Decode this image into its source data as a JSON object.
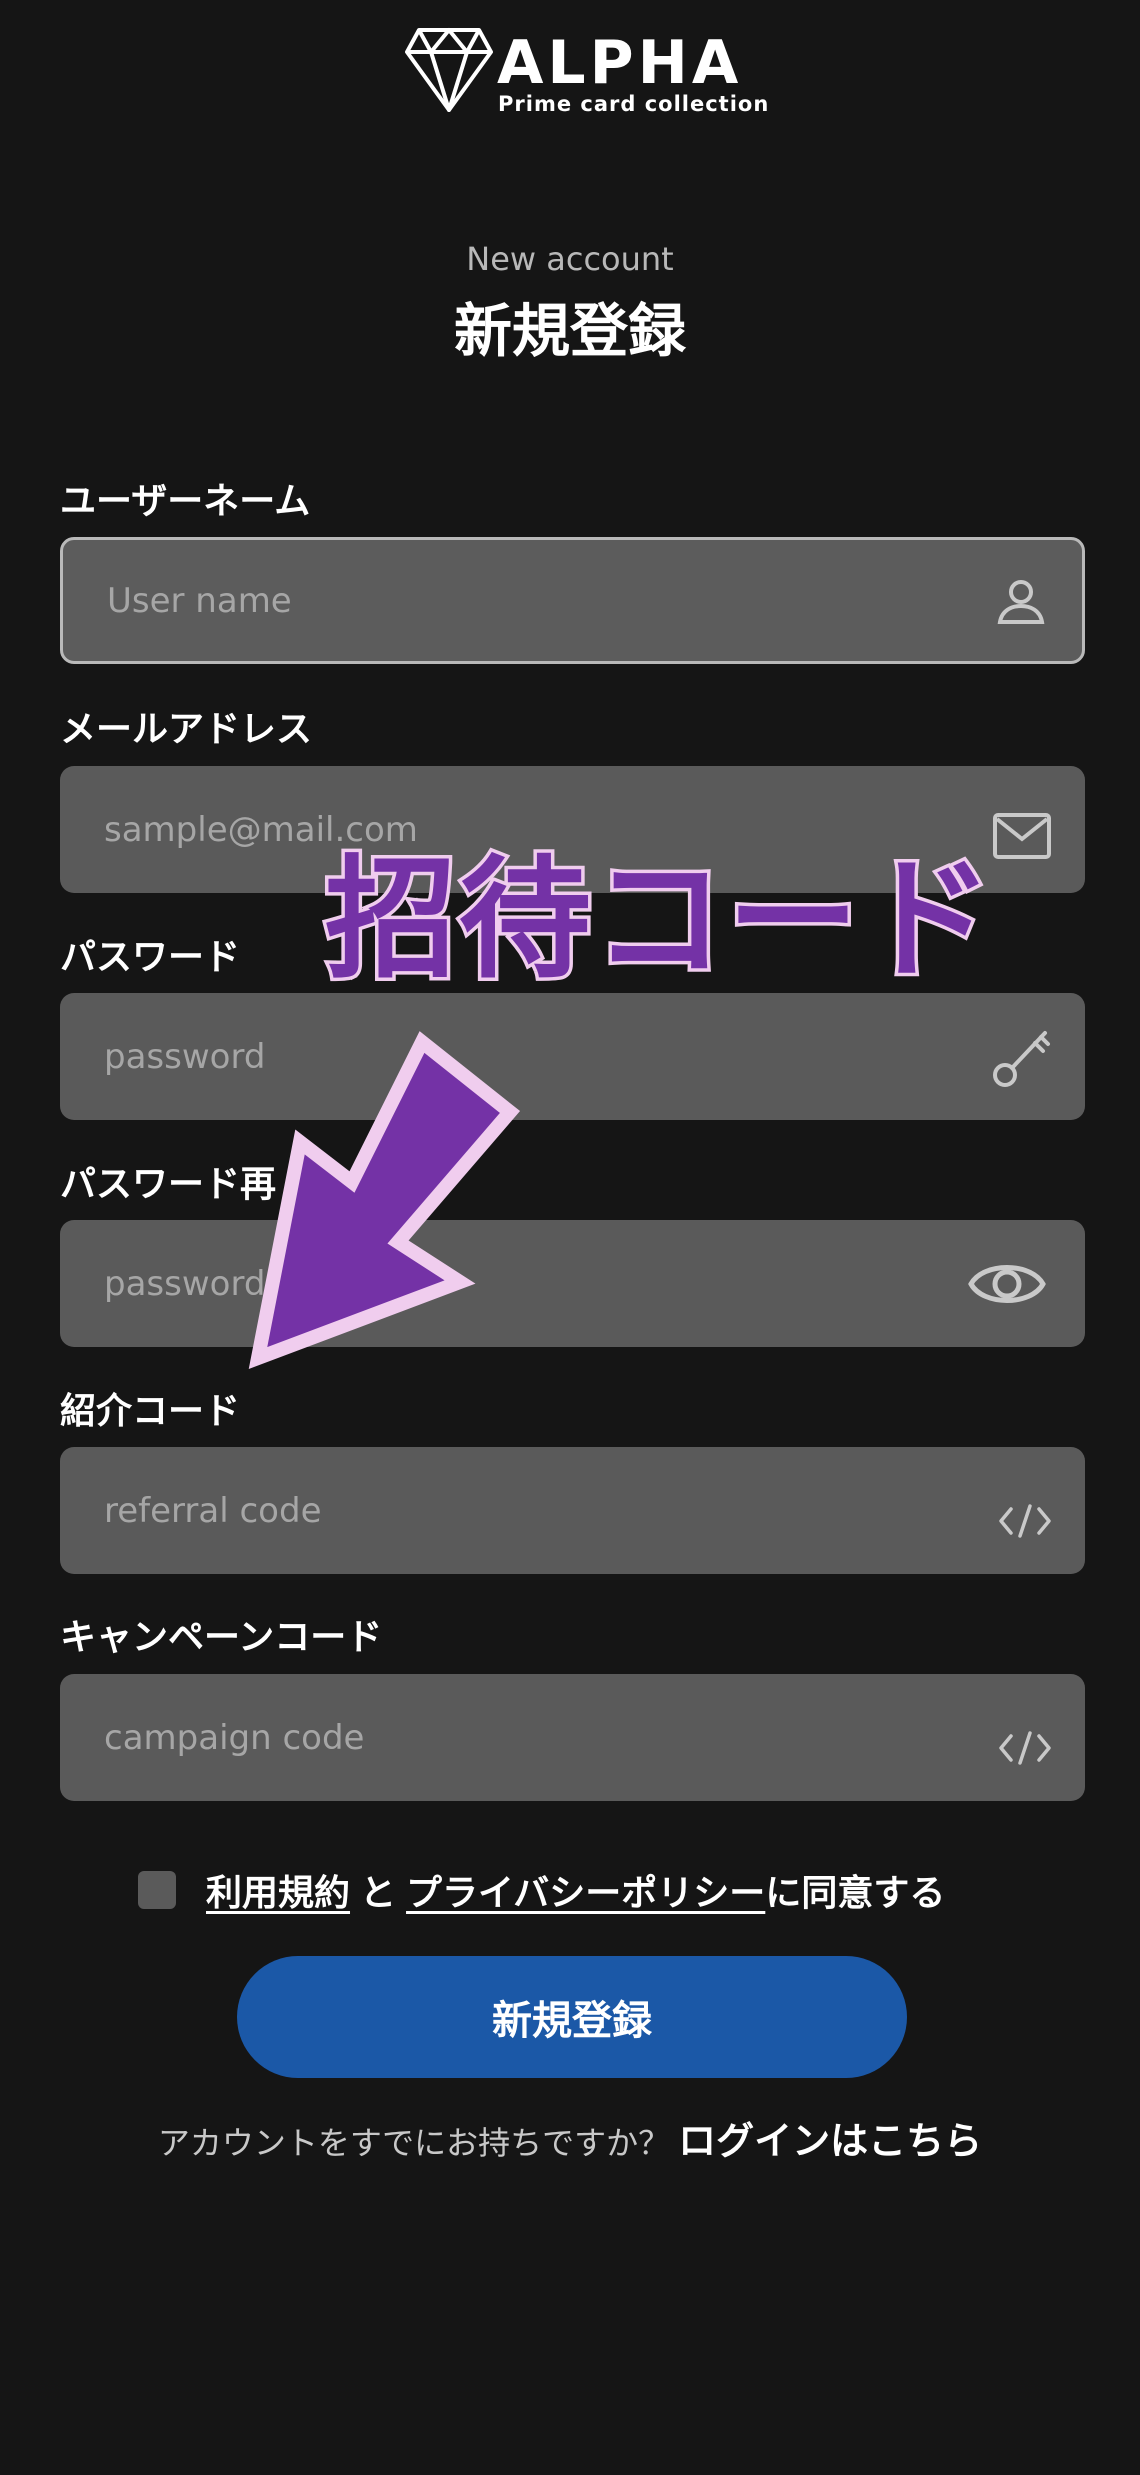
{
  "logo": {
    "title": "ALPHA",
    "subtitle": "Prime card collection",
    "icon": "diamond-icon"
  },
  "header": {
    "subtitle_en": "New account",
    "title_jp": "新規登録"
  },
  "form": {
    "username": {
      "label": "ユーザーネーム",
      "placeholder": "User name",
      "icon": "user-icon"
    },
    "email": {
      "label": "メールアドレス",
      "placeholder": "sample@mail.com",
      "icon": "mail-icon"
    },
    "password": {
      "label": "パスワード",
      "placeholder": "password",
      "icon": "key-icon"
    },
    "password_confirm": {
      "label": "パスワード再",
      "placeholder": "password",
      "icon": "eye-icon"
    },
    "referral": {
      "label": "紹介コード",
      "placeholder": "referral code",
      "icon": "code-icon"
    },
    "campaign": {
      "label": "キャンペーンコード",
      "placeholder": "campaign code",
      "icon": "code-icon"
    }
  },
  "agreement": {
    "terms_link": "利用規約",
    "and": "と",
    "privacy_link": "プライバシーポリシー",
    "suffix": "に同意する",
    "checked": false
  },
  "submit_label": "新規登録",
  "login": {
    "question": "アカウントをすでにお持ちですか？",
    "link": "ログインはこちら"
  },
  "annotation": {
    "text": "招待コード",
    "colors": {
      "fill": "#7432a6",
      "stroke": "#f0cdee"
    }
  },
  "colors": {
    "background": "#151515",
    "field": "#5a5a5a",
    "button": "#1b58a7"
  }
}
